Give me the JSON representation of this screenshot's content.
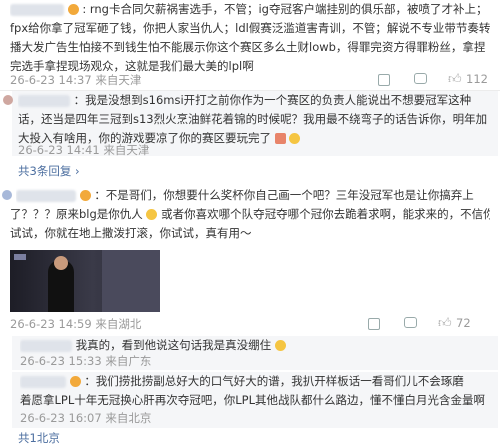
{
  "comment1": {
    "text_lines": [
      ": rng卡合同欠薪祸害选手，不管；ig夺冠客户端挂别的俱乐部，被喷了才补上；",
      "fpx给你拿了冠军砸了钱，你把人家当仇人；ldl假赛泛滥道害青训，不管；解说不专业带节奏转",
      "播大发广告生怕接不到钱生怕不能展示你这个赛区多么土财lowb，得罪完资方得罪粉丝，拿捏",
      "完选手拿捏现场观众，这就是我们最大美的lpl啊"
    ],
    "meta": "26-6-23 14:37 来自天津",
    "likes": "112"
  },
  "comment2": {
    "text_lines": [
      "：我是没想到s16msi开打之前你作为一个赛区的负责人能说出不想要冠军这种",
      "话，还当是四年三冠到s13烈火烹油鲜花着锦的时候呢？我用最不绕弯子的话告诉你，明年加",
      "大投入有啥用，你的游戏要凉了你的赛区要玩完了"
    ],
    "meta": "26-6-23 14:41 来自天津",
    "reply_count": "共3条回复"
  },
  "comment3": {
    "text_lines": [
      "：不是哥们，你想要什么奖杯你自己画一个吧？三年没冠军也是让你搞弃上",
      "了？？？原来blg是你仇人",
      "试试，你就在地上撒泼打滚，你试试，真有用～"
    ],
    "line2_mid": "或者你喜欢哪个队夺冠夺哪个冠你去跪着求啊，能求来的，不信你",
    "meta": "26-6-23 14:59 来自湖北",
    "likes": "72"
  },
  "reply1": {
    "text": "我真的，看到他说这句话我是真没绷住",
    "meta": "26-6-23 15:33 来自广东"
  },
  "reply2": {
    "text_lines": [
      "：我们捞批捞副总好大的口气好大的谱，我扒开样板话一看哥们儿不会琢磨",
      "着愿拿LPL十年无冠换心肝再次夺冠吧，你LPL其他战队都什么路边，懂不懂白月光含金量啊"
    ],
    "meta": "26-6-23 16:07 来自北京"
  },
  "reply_more": "共1北京"
}
